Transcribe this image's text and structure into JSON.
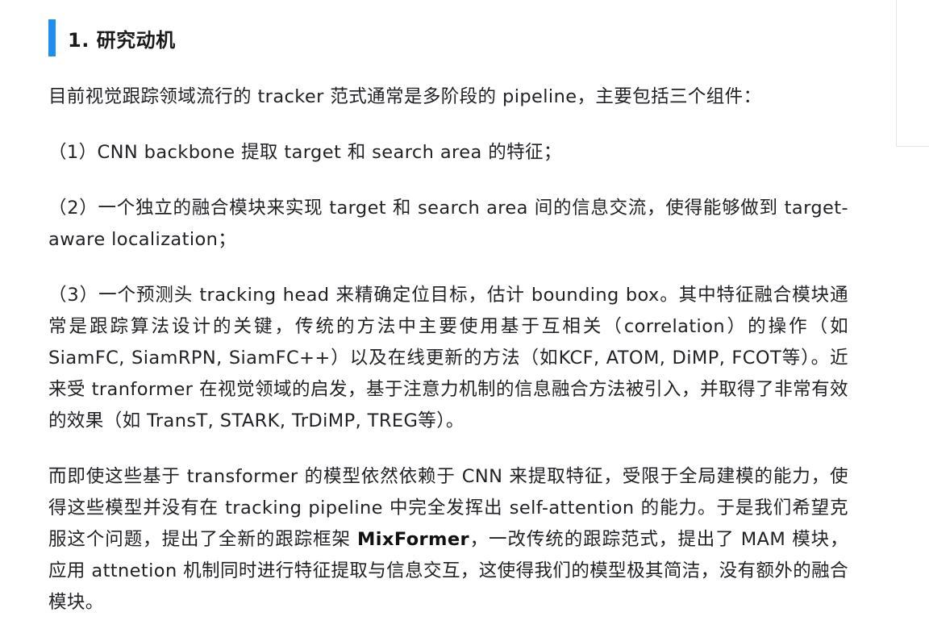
{
  "section": {
    "title": "1. 研究动机"
  },
  "paragraphs": {
    "intro": "目前视觉跟踪领域流行的 tracker 范式通常是多阶段的 pipeline，主要包括三个组件：",
    "item1": "（1）CNN backbone 提取 target 和 search area 的特征；",
    "item2": "（2）一个独立的融合模块来实现 target 和 search area 间的信息交流，使得能够做到 target-aware localization；",
    "item3": "（3）一个预测头 tracking head 来精确定位目标，估计 bounding box。其中特征融合模块通常是跟踪算法设计的关键，传统的方法中主要使用基于互相关（correlation）的操作（如 SiamFC, SiamRPN, SiamFC++）以及在线更新的方法（如KCF, ATOM, DiMP, FCOT等）。近来受 tranformer 在视觉领域的启发，基于注意力机制的信息融合方法被引入，并取得了非常有效的效果（如 TransT, STARK, TrDiMP, TREG等）。",
    "mix_before": "而即使这些基于 transformer 的模型依然依赖于 CNN 来提取特征，受限于全局建模的能力，使得这些模型并没有在 tracking pipeline 中完全发挥出 self-attention 的能力。于是我们希望克服这个问题，提出了全新的跟踪框架 ",
    "mix_emph": "MixFormer",
    "mix_after": "，一改传统的跟踪范式，提出了 MAM 模块，应用 attnetion 机制同时进行特征提取与信息交互，这使得我们的模型极其简洁，没有额外的融合模块。"
  },
  "colors": {
    "accent": "#1f8ef1",
    "text": "#222226"
  }
}
